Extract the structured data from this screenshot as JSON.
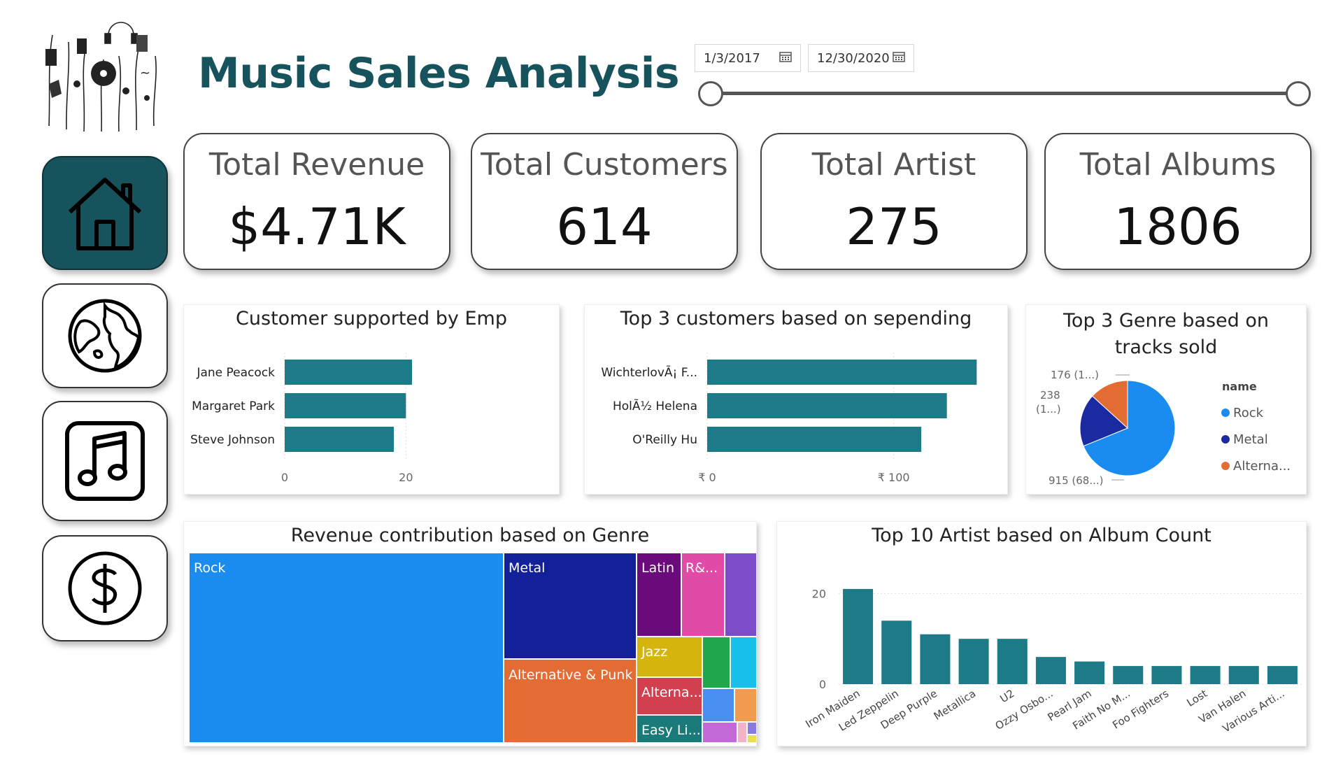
{
  "header": {
    "title": "Music Sales Analysis",
    "date_start": "1/3/2017",
    "date_end": "12/30/2020"
  },
  "nav": [
    {
      "name": "home",
      "icon": "home-icon"
    },
    {
      "name": "globe",
      "icon": "globe-icon"
    },
    {
      "name": "music",
      "icon": "music-note-icon"
    },
    {
      "name": "dollar",
      "icon": "dollar-icon"
    }
  ],
  "kpis": {
    "revenue": {
      "label": "Total Revenue",
      "value": "$4.71K"
    },
    "customers": {
      "label": "Total Customers",
      "value": "614"
    },
    "artist": {
      "label": "Total Artist",
      "value": "275"
    },
    "albums": {
      "label": "Total Albums",
      "value": "1806"
    }
  },
  "colors": {
    "accent": "#16535c",
    "bar": "#1c7b86",
    "rock": "#1a8cf0",
    "metal": "#1a2aa0",
    "alternative": "#e36c35"
  },
  "chart_data": [
    {
      "id": "emp",
      "type": "bar",
      "orientation": "horizontal",
      "title": "Customer supported by Emp",
      "categories": [
        "Jane Peacock",
        "Margaret Park",
        "Steve Johnson"
      ],
      "values": [
        21,
        20,
        18
      ],
      "xlim": [
        0,
        30
      ],
      "xticks": [
        "0",
        "20"
      ],
      "xtick_values": [
        0,
        20
      ]
    },
    {
      "id": "top_customers",
      "type": "bar",
      "orientation": "horizontal",
      "title": "Top 3 customers based on sepending",
      "categories": [
        "WichterlovÃ¡ F...",
        "HolÃ½ Helena",
        "O'Reilly Hu"
      ],
      "values": [
        144.5,
        128.5,
        114.8
      ],
      "xlim": [
        0,
        150
      ],
      "xticks": [
        "₹ 0",
        "₹ 100"
      ],
      "xtick_values": [
        0,
        100
      ]
    },
    {
      "id": "genre_pie",
      "type": "pie",
      "title": "Top 3 Genre based on tracks sold",
      "legend_title": "name",
      "legend_position": "right",
      "series": [
        {
          "name": "Rock",
          "value": 915,
          "label": "915 (68...)",
          "color": "#1a8cf0"
        },
        {
          "name": "Metal",
          "value": 238,
          "label": "238 (1...)",
          "color": "#1a2aa0"
        },
        {
          "name": "Alterna...",
          "value": 176,
          "label": "176 (1...)",
          "color": "#e36c35"
        }
      ]
    },
    {
      "id": "genre_treemap",
      "type": "treemap",
      "title": "Revenue contribution based on Genre",
      "labels": [
        "Rock",
        "Metal",
        "Alternative & Punk",
        "Latin",
        "R&...",
        "Jazz",
        "Alterna...",
        "Easy Li..."
      ]
    },
    {
      "id": "artist_albums",
      "type": "bar",
      "title": "Top 10 Artist based on Album Count",
      "categories": [
        "Iron Maiden",
        "Led Zeppelin",
        "Deep Purple",
        "Metallica",
        "U2",
        "Ozzy Osbo...",
        "Pearl Jam",
        "Faith No M...",
        "Foo Fighters",
        "Lost",
        "Van Halen",
        "Various Arti..."
      ],
      "values": [
        21,
        14,
        11,
        10,
        10,
        6,
        5,
        4,
        4,
        4,
        4,
        4
      ],
      "ylim": [
        0,
        25
      ],
      "yticks": [
        "0",
        "20"
      ],
      "ytick_values": [
        0,
        20
      ],
      "grid": true
    }
  ]
}
